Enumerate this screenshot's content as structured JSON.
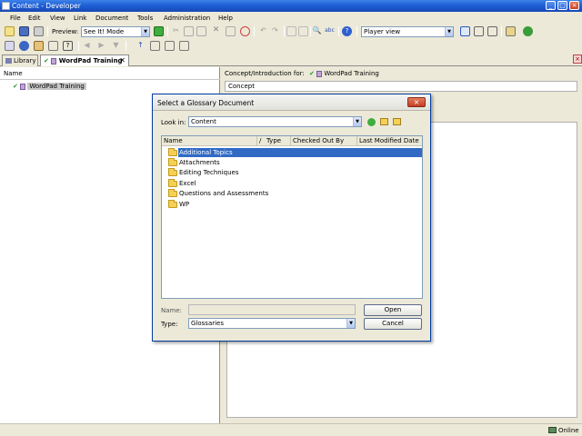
{
  "window": {
    "title": "Content - Developer"
  },
  "menu": [
    "File",
    "Edit",
    "View",
    "Link",
    "Document",
    "Tools",
    "Administration",
    "Help"
  ],
  "toolbar": {
    "preview_label": "Preview:",
    "preview_mode": "See It! Mode",
    "view_mode": "Player view"
  },
  "tabs": {
    "library": "Library",
    "document": "WordPad Training"
  },
  "left_pane": {
    "column_name": "Name",
    "tree_item": "WordPad Training"
  },
  "right_pane": {
    "concept_for_label": "Concept/Introduction for:",
    "concept_for_doc": "WordPad Training",
    "concept_tab": "Concept"
  },
  "dialog": {
    "title": "Select a Glossary Document",
    "look_in_label": "Look in:",
    "look_in_value": "Content",
    "columns": [
      "Name",
      "/",
      "Type",
      "Checked Out By",
      "Last Modified Date"
    ],
    "folders": [
      "Additional Topics",
      "Attachments",
      "Editing Techniques",
      "Excel",
      "Questions and Assessments",
      "WP"
    ],
    "selected_index": 0,
    "name_label": "Name:",
    "name_value": "",
    "type_label": "Type:",
    "type_value": "Glossaries",
    "open_label": "Open",
    "cancel_label": "Cancel"
  },
  "status": {
    "online": "Online"
  },
  "colors": {
    "titlebar": "#1f5fd6",
    "selection": "#316ac5",
    "chrome": "#ece9d8"
  }
}
